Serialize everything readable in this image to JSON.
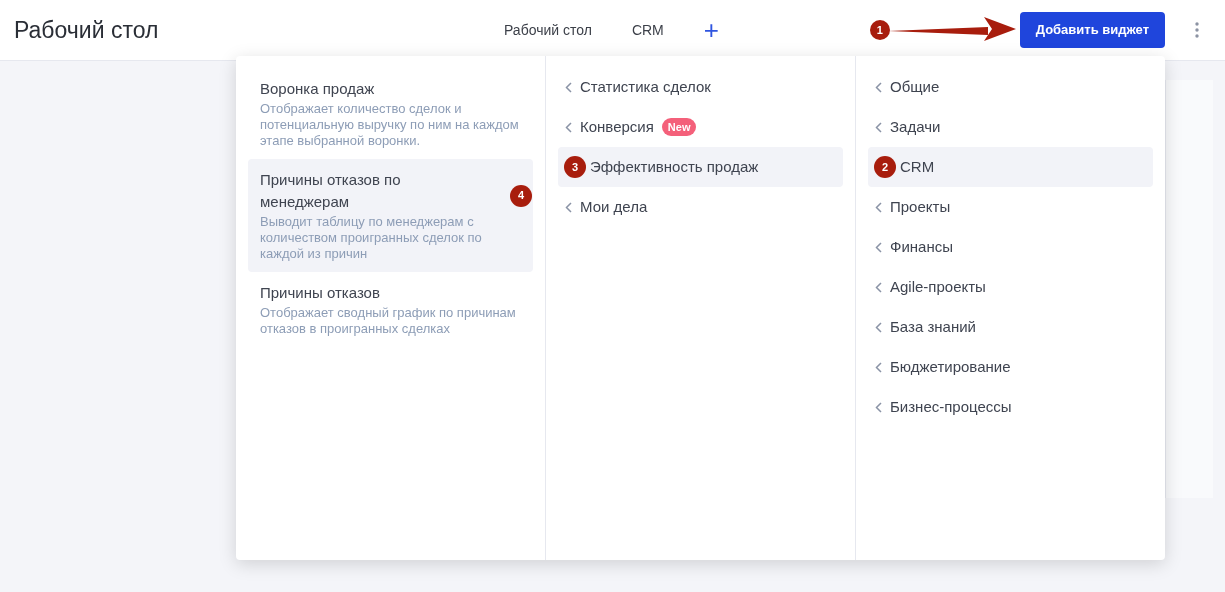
{
  "header": {
    "title": "Рабочий стол",
    "tabs": [
      {
        "label": "Рабочий стол",
        "selected": false
      },
      {
        "label": "CRM",
        "selected": false
      }
    ],
    "add_tab": "+",
    "add_widget_button": "Добавить виджет",
    "button_marker": "1"
  },
  "menu": {
    "widgets": [
      {
        "title": "Воронка продаж",
        "description": "Отображает количество сделок и потенциальную выручку по ним на каждом этапе выбранной воронки.",
        "selected": false
      },
      {
        "title": "Причины отказов по менеджерам",
        "description": "Выводит таблицу по менеджерам с количеством проигранных сделок по каждой из причин",
        "selected": true,
        "marker": "4"
      },
      {
        "title": "Причины отказов",
        "description": "Отображает сводный график по причинам отказов в проигранных сделках",
        "selected": false
      }
    ],
    "groups": [
      {
        "label": "Статистика сделок",
        "selected": false
      },
      {
        "label": "Конверсия",
        "selected": false,
        "badge": "New"
      },
      {
        "label": "Эффективность продаж",
        "selected": true,
        "marker": "3"
      },
      {
        "label": "Мои дела",
        "selected": false
      }
    ],
    "categories": [
      {
        "label": "Общие",
        "selected": false
      },
      {
        "label": "Задачи",
        "selected": false
      },
      {
        "label": "CRM",
        "selected": true,
        "marker": "2"
      },
      {
        "label": "Проекты",
        "selected": false
      },
      {
        "label": "Финансы",
        "selected": false
      },
      {
        "label": "Agile-проекты",
        "selected": false
      },
      {
        "label": "База знаний",
        "selected": false
      },
      {
        "label": "Бюджетирование",
        "selected": false
      },
      {
        "label": "Бизнес-процессы",
        "selected": false
      }
    ]
  }
}
